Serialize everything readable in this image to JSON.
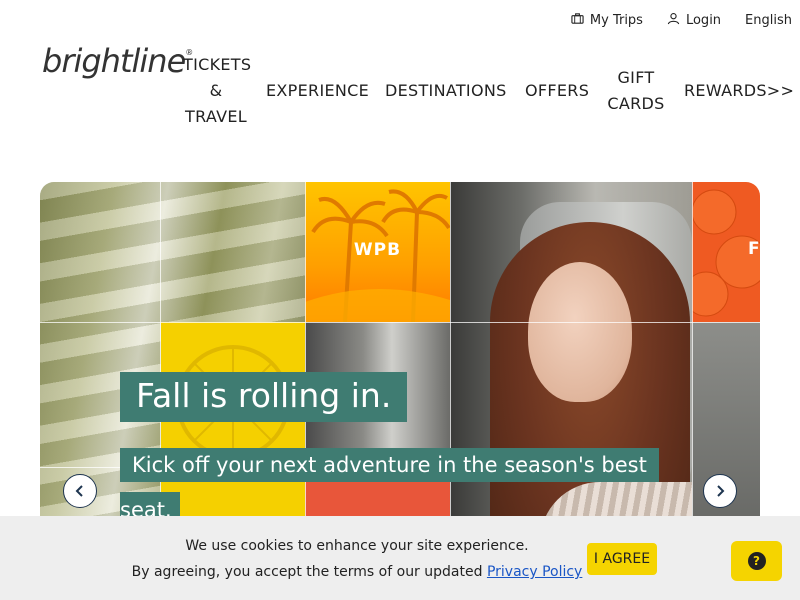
{
  "utility": {
    "my_trips": "My Trips",
    "login": "Login",
    "language": "English"
  },
  "logo": {
    "text": "brightline",
    "mark": "®"
  },
  "nav": {
    "tickets_line1": "TICKETS",
    "tickets_line2": "&",
    "tickets_line3": "TRAVEL",
    "experience": "EXPERIENCE",
    "destinations": "DESTINATIONS",
    "offers": "OFFERS",
    "gift_line1": "GIFT",
    "gift_line2": "CARDS",
    "rewards": "REWARDS>>"
  },
  "hero": {
    "tile_wpb": "WPB",
    "tile_f": "F",
    "headline": "Fall is rolling in.",
    "subhead_line1": "Kick off your next adventure in the season's best",
    "subhead_line2": "seat."
  },
  "cookie": {
    "line1": "We use cookies to enhance your site experience.",
    "line2_prefix": "By agreeing, you accept the terms of our updated ",
    "privacy_link": "Privacy Policy",
    "agree_button": "I AGREE"
  },
  "help": {
    "glyph": "?"
  },
  "colors": {
    "brand_yellow": "#f5d400",
    "teal_overlay": "#3f7c72",
    "link_blue": "#1a56c6",
    "banner_bg": "#eeeeee"
  }
}
